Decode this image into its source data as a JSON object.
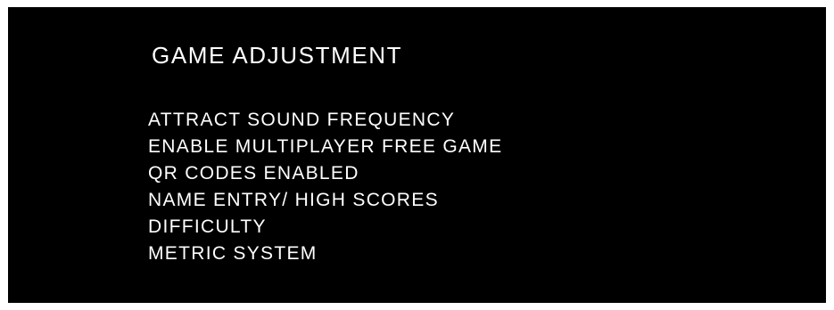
{
  "menu": {
    "title": "GAME ADJUSTMENT",
    "items": [
      {
        "label": "ATTRACT SOUND FREQUENCY"
      },
      {
        "label": "ENABLE MULTIPLAYER FREE GAME"
      },
      {
        "label": "QR CODES ENABLED"
      },
      {
        "label": "NAME ENTRY/ HIGH SCORES"
      },
      {
        "label": "DIFFICULTY"
      },
      {
        "label": "METRIC SYSTEM"
      }
    ]
  },
  "colors": {
    "background": "#000000",
    "text": "#ffffff",
    "frame": "#ffffff"
  }
}
